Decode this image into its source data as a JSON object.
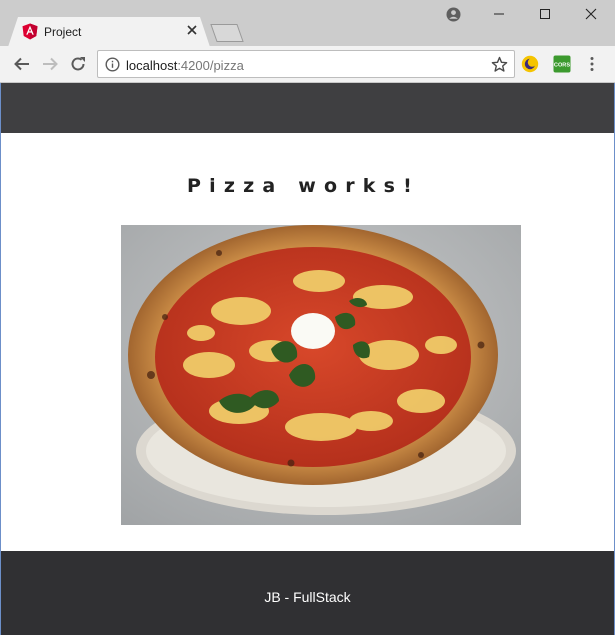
{
  "browser": {
    "tab": {
      "title": "Project",
      "favicon": "angular-icon"
    },
    "url": {
      "host": "localhost",
      "path": ":4200/pizza"
    },
    "extensions": [
      {
        "name": "night-mode-icon"
      },
      {
        "name": "cors-icon",
        "label": "CORS"
      }
    ],
    "window_controls": [
      "account-icon",
      "minimize-icon",
      "maximize-icon",
      "close-icon"
    ],
    "nav_icons": [
      "back-arrow-icon",
      "forward-arrow-icon",
      "reload-icon",
      "menu-icon"
    ]
  },
  "page": {
    "heading": "Pizza works!",
    "image": {
      "subject": "margherita pizza"
    },
    "footer": "JB - FullStack"
  },
  "colors": {
    "header_bg": "#3f3f41",
    "footer_bg": "#303033",
    "chrome_bg": "#cccccc",
    "toolbar_bg": "#f2f2f2"
  }
}
